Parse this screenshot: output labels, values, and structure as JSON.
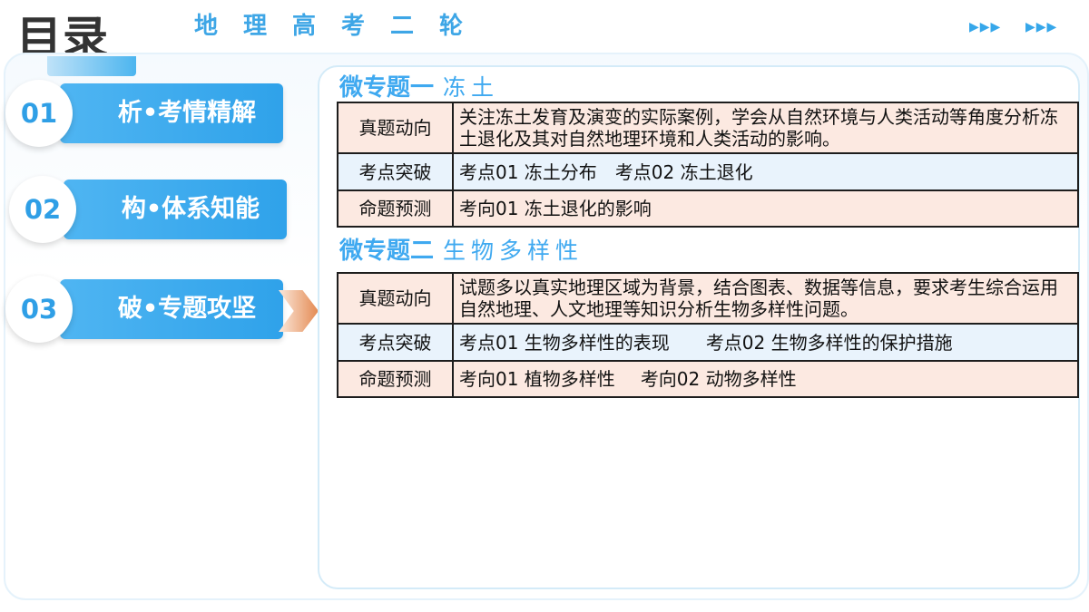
{
  "header": {
    "main_title": "目录",
    "sub_title": "地理高考二轮",
    "arrow_group_1": "▶▶▶",
    "arrow_group_2": "▶▶▶"
  },
  "nav": {
    "items": [
      {
        "number": "01",
        "label": "析•考情精解"
      },
      {
        "number": "02",
        "label": "构•体系知能"
      },
      {
        "number": "03",
        "label": "破•专题攻坚"
      }
    ],
    "active_index": 2
  },
  "sections": [
    {
      "topic": "微专题一",
      "name": "冻土",
      "rows": [
        {
          "label": "真题动向",
          "value": "关注冻土发育及演变的实际案例，学会从自然环境与人类活动等角度分析冻土退化及其对自然地理环境和人类活动的影响。"
        },
        {
          "label": "考点突破",
          "parts": [
            "考点01 冻土分布",
            "考点02 冻土退化"
          ]
        },
        {
          "label": "命题预测",
          "parts": [
            "考向01 冻土退化的影响"
          ]
        }
      ]
    },
    {
      "topic": "微专题二",
      "name": "生物多样性",
      "rows": [
        {
          "label": "真题动向",
          "value": "试题多以真实地理区域为背景，结合图表、数据等信息，要求考生综合运用自然地理、人文地理等知识分析生物多样性问题。"
        },
        {
          "label": "考点突破",
          "parts": [
            "考点01 生物多样性的表现",
            "考点02  生物多样性的保护措施"
          ]
        },
        {
          "label": "命题预测",
          "parts": [
            "考向01 植物多样性",
            "考向02 动物多样性"
          ]
        }
      ]
    }
  ],
  "colors": {
    "accent_blue": "#3ea6e6",
    "row_pink": "#fce9e1",
    "row_blue": "#e9f3fc",
    "pointer_orange": "#e48a52"
  }
}
